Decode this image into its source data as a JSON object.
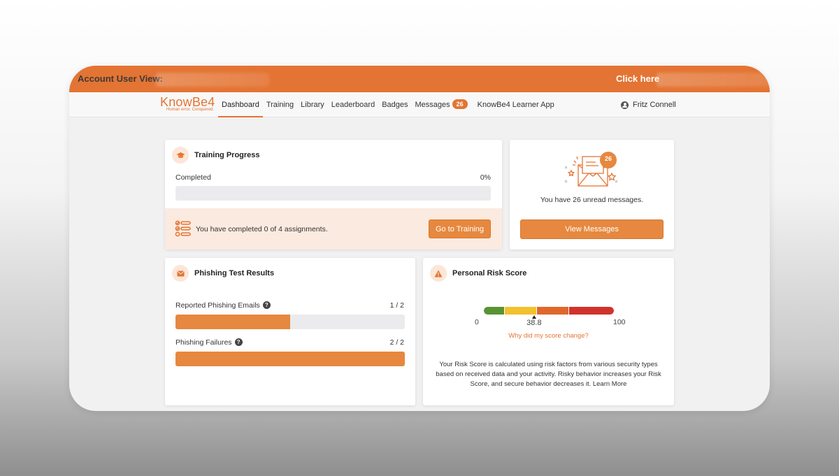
{
  "account_bar": {
    "label": "Account User View:",
    "click_label": "Click here"
  },
  "nav": {
    "logo_text": "KnowBe4",
    "logo_tagline": "Human error. Conquered.",
    "items": [
      {
        "label": "Dashboard",
        "active": true
      },
      {
        "label": "Training"
      },
      {
        "label": "Library"
      },
      {
        "label": "Leaderboard"
      },
      {
        "label": "Badges"
      },
      {
        "label": "Messages",
        "badge": "26"
      },
      {
        "label": "KnowBe4 Learner App"
      }
    ],
    "user_name": "Fritz Connell"
  },
  "training": {
    "title": "Training Progress",
    "completed_label": "Completed",
    "percent_label": "0%",
    "progress_fraction": 0,
    "assignments_text": "You have completed 0 of 4 assignments.",
    "button_label": "Go to Training"
  },
  "messages": {
    "badge": "26",
    "text": "You have 26 unread messages.",
    "button_label": "View Messages"
  },
  "phishing": {
    "title": "Phishing Test Results",
    "reported_label": "Reported Phishing Emails",
    "reported_value": "1 / 2",
    "reported_fraction": 0.5,
    "failures_label": "Phishing Failures",
    "failures_value": "2 / 2",
    "failures_fraction": 1.0,
    "help_glyph": "?"
  },
  "risk": {
    "title": "Personal Risk Score",
    "min_label": "0",
    "max_label": "100",
    "score_label": "38.8",
    "score": 38.8,
    "link_text": "Why did my score change?",
    "description": "Your Risk Score is calculated using risk factors from various security types based on received data and your activity. Risky behavior increases your Risk Score, and secure behavior decreases it. Learn More",
    "segment_colors": [
      "#5a9334",
      "#f2c12e",
      "#e0682c",
      "#d2322c"
    ]
  },
  "colors": {
    "accent": "#e47433",
    "button": "#e6883f"
  }
}
